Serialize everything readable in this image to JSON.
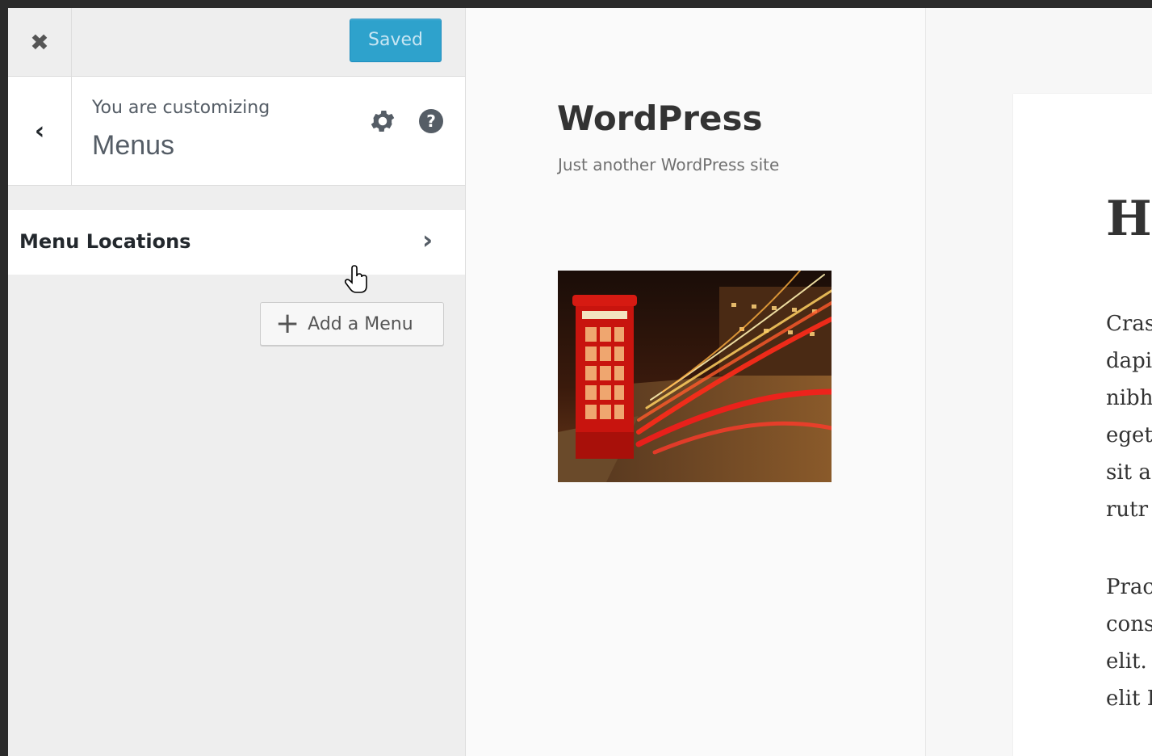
{
  "customizer": {
    "close_icon": "close-icon",
    "save_button": "Saved",
    "back_icon": "chevron-left-icon",
    "customizing_label": "You are customizing",
    "panel_title": "Menus",
    "settings_icon": "gear-icon",
    "help_icon": "help-icon",
    "help_glyph": "?",
    "sections": [
      {
        "label": "Menu Locations",
        "icon": "chevron-right-icon"
      }
    ],
    "add_menu_label": "Add a Menu"
  },
  "preview": {
    "site_title": "WordPress",
    "site_tagline": "Just another WordPress site",
    "image": "red phone booth with light trails at night",
    "post_title": "He",
    "post_paragraph_1": [
      "Cras",
      "dapi",
      "nibh",
      "eget",
      "sit a",
      "rutr"
    ],
    "post_paragraph_2": [
      "Prac",
      "cons",
      "elit.",
      "elit I"
    ]
  },
  "colors": {
    "primary_button": "#2ea2cc",
    "sidebar_bg": "#eeeeee",
    "page_bg": "#2b2b2b"
  }
}
